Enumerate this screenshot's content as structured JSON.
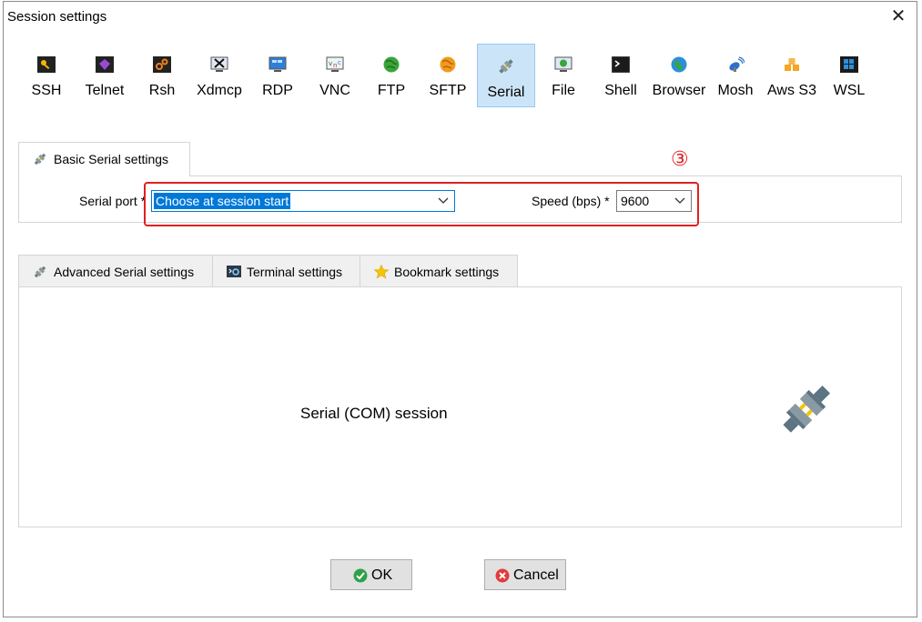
{
  "window": {
    "title": "Session settings"
  },
  "protocols": [
    {
      "label": "SSH",
      "icon": "key-icon"
    },
    {
      "label": "Telnet",
      "icon": "telnet-icon"
    },
    {
      "label": "Rsh",
      "icon": "rsh-icon"
    },
    {
      "label": "Xdmcp",
      "icon": "x-monitor-icon"
    },
    {
      "label": "RDP",
      "icon": "rdp-monitor-icon"
    },
    {
      "label": "VNC",
      "icon": "vnc-icon"
    },
    {
      "label": "FTP",
      "icon": "ftp-globe-icon"
    },
    {
      "label": "SFTP",
      "icon": "sftp-globe-icon"
    },
    {
      "label": "Serial",
      "icon": "serial-plug-icon",
      "selected": true
    },
    {
      "label": "File",
      "icon": "file-monitor-icon"
    },
    {
      "label": "Shell",
      "icon": "terminal-icon"
    },
    {
      "label": "Browser",
      "icon": "browser-globe-icon"
    },
    {
      "label": "Mosh",
      "icon": "satellite-icon"
    },
    {
      "label": "Aws S3",
      "icon": "aws-cubes-icon"
    },
    {
      "label": "WSL",
      "icon": "windows-icon"
    }
  ],
  "basic_tab": {
    "label": "Basic Serial settings"
  },
  "serial_port": {
    "label": "Serial port *",
    "value": "Choose at session start"
  },
  "speed": {
    "label": "Speed (bps) *",
    "value": "9600"
  },
  "annotation": {
    "number": "③",
    "color": "#e02020"
  },
  "lower_tabs": [
    {
      "label": "Advanced Serial settings",
      "icon": "serial-plug-icon"
    },
    {
      "label": "Terminal settings",
      "icon": "terminal-settings-icon"
    },
    {
      "label": "Bookmark settings",
      "icon": "star-icon"
    }
  ],
  "session_description": "Serial (COM) session",
  "buttons": {
    "ok": "OK",
    "cancel": "Cancel"
  },
  "colors": {
    "selected_bg": "#cce4f7",
    "focus_border": "#0078d7",
    "annotation": "#e02020"
  }
}
